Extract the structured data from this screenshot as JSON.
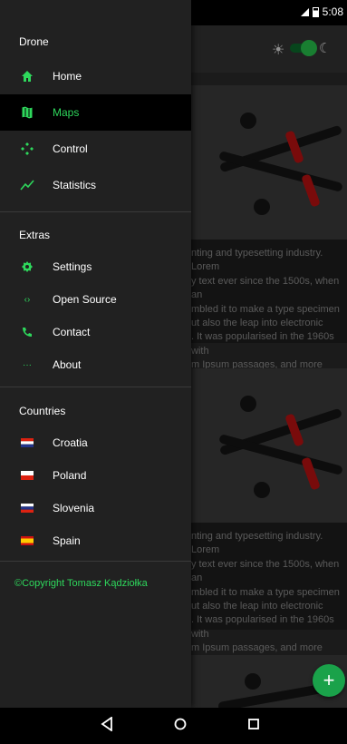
{
  "status_bar": {
    "time": "5:08",
    "left_icon": "android-notification-icon"
  },
  "drawer": {
    "header": "Drone",
    "main_items": [
      {
        "label": "Home",
        "icon": "home-icon"
      },
      {
        "label": "Maps",
        "icon": "map-icon",
        "selected": true
      },
      {
        "label": "Control",
        "icon": "gamepad-icon"
      },
      {
        "label": "Statistics",
        "icon": "trending-up-icon"
      }
    ],
    "extras_title": "Extras",
    "extras_items": [
      {
        "label": "Settings",
        "icon": "settings-icon"
      },
      {
        "label": "Open Source",
        "icon": "code-icon"
      },
      {
        "label": "Contact",
        "icon": "phone-icon"
      },
      {
        "label": "About",
        "icon": "more-icon"
      }
    ],
    "countries_title": "Countries",
    "countries": [
      {
        "label": "Croatia",
        "flag": "flag-croatia"
      },
      {
        "label": "Poland",
        "flag": "flag-poland"
      },
      {
        "label": "Slovenia",
        "flag": "flag-slovenia"
      },
      {
        "label": "Spain",
        "flag": "flag-spain"
      }
    ],
    "copyright": "©Copyright Tomasz Kądziołka"
  },
  "cards": [
    {
      "text": "nting and typesetting industry. Lorem\ny text ever since the 1500s, when an\nmbled it to make a type specimen\nut also the leap into electronic\n. It was popularised in the 1960s with\nm Ipsum passages, and more recently"
    },
    {
      "text": "nting and typesetting industry. Lorem\ny text ever since the 1500s, when an\nmbled it to make a type specimen\nut also the leap into electronic\n. It was popularised in the 1960s with\nm Ipsum passages, and more recently"
    }
  ],
  "fab": {
    "label": "+"
  },
  "colors": {
    "accent": "#2ed85c",
    "drawer_bg": "#212121",
    "selected_bg": "#000000"
  }
}
